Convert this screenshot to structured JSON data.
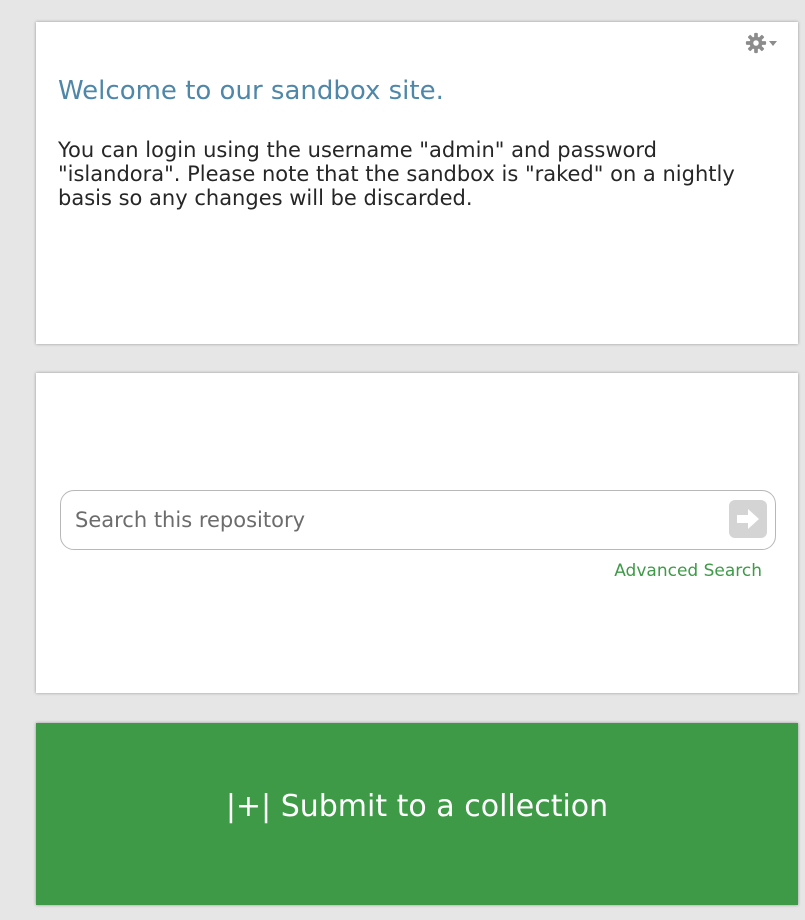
{
  "welcome": {
    "title": "Welcome to our sandbox site.",
    "body": "You can login using the username \"admin\" and password \"islandora\". Please note that the sandbox is \"raked\" on a nightly basis so any changes will be discarded.",
    "gear_icon": "gear-icon",
    "dropdown_icon": "caret-down-icon"
  },
  "search": {
    "placeholder": "Search this repository",
    "value": "",
    "submit_icon": "arrow-right-icon",
    "advanced_label": "Advanced Search"
  },
  "submit": {
    "label": "|+| Submit to a collection"
  },
  "colors": {
    "background": "#e6e6e6",
    "title": "#4f87a8",
    "accent_green": "#3e9a47",
    "search_button": "#d4d4d4"
  }
}
